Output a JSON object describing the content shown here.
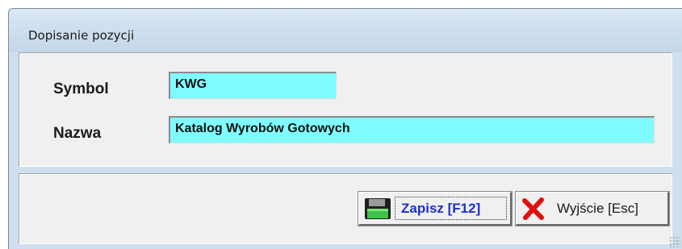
{
  "window": {
    "title": "Dopisanie pozycji"
  },
  "form": {
    "symbol_label": "Symbol",
    "symbol_value": "KWG",
    "name_label": "Nazwa",
    "name_value": "Katalog Wyrobów Gotowych"
  },
  "buttons": {
    "save_label": "Zapisz  [F12]",
    "save_icon": "floppy-disk-icon",
    "exit_label": "Wyjście  [Esc]",
    "exit_icon": "red-x-icon"
  },
  "colors": {
    "field_bg": "#7ffcff",
    "save_text": "#1b2fd0",
    "exit_icon": "#e01010"
  }
}
